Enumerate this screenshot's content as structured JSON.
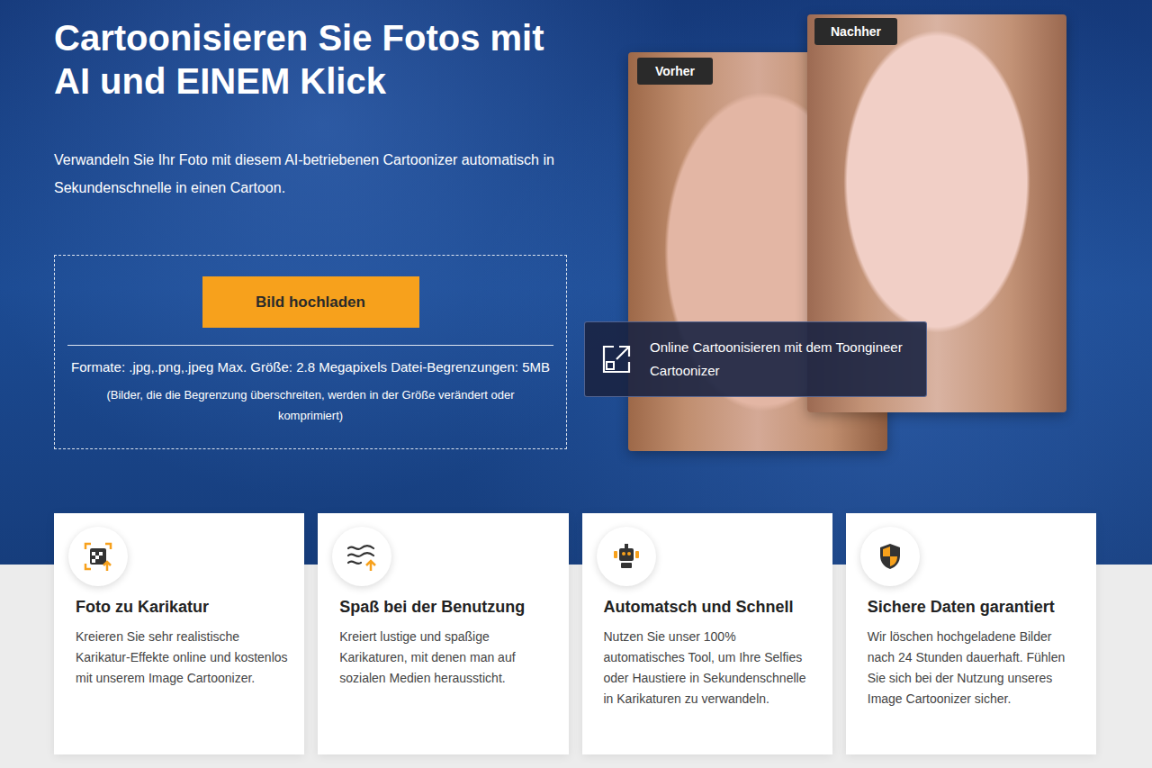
{
  "hero": {
    "title_lines": [
      "Cartoonisieren Sie Fotos mit",
      "AI und EINEM Klick"
    ],
    "subtitle": "Verwandeln Sie Ihr Foto mit diesem AI-betriebenen Cartoonizer automatisch in Sekundenschnelle in einen Cartoon.",
    "upload_button": "Bild hochladen",
    "formats": "Formate: .jpg,.png,.jpeg Max. Größe: 2.8 Megapixels Datei-Begrenzungen: 5MB",
    "note": "(Bilder, die die Begrenzung überschreiten, werden in der Größe verändert oder komprimiert)"
  },
  "preview": {
    "before_label": "Vorher",
    "after_label": "Nachher",
    "link_text": "Online Cartoonisieren mit dem Toongineer Cartoonizer"
  },
  "features": [
    {
      "title": "Foto zu Karikatur",
      "text": "Kreieren Sie sehr realistische Karikatur-Effekte online und kostenlos mit unserem Image Cartoonizer."
    },
    {
      "title": "Spaß bei der Benutzung",
      "text": "Kreiert lustige und spaßige Karikaturen, mit denen man auf sozialen Medien heraussticht."
    },
    {
      "title": "Automatsch und Schnell",
      "text": "Nutzen Sie unser 100% automatisches Tool, um Ihre Selfies oder Haustiere in Sekundenschnelle in Karikaturen zu verwandeln."
    },
    {
      "title": "Sichere Daten garantiert",
      "text": "Wir löschen hochgeladene Bilder nach 24 Stunden dauerhaft. Fühlen Sie sich bei der Nutzung unseres Image Cartoonizer sicher."
    }
  ]
}
